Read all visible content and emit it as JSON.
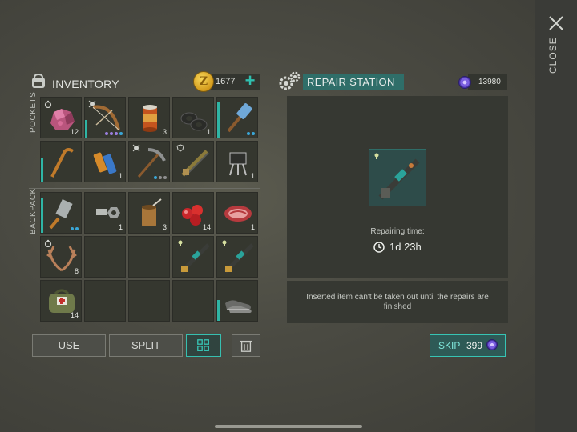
{
  "close": {
    "label": "CLOSE"
  },
  "inventory": {
    "title": "INVENTORY",
    "coins": "1677",
    "sections": {
      "pockets": "POCKETS",
      "backpack": "BACKPACK"
    },
    "items": [
      {
        "icon": "raw-ore-icon",
        "count": "12"
      },
      {
        "icon": "bow-icon",
        "count": ""
      },
      {
        "icon": "canned-food-icon",
        "count": "3"
      },
      {
        "icon": "duct-tape-icon",
        "count": "1"
      },
      {
        "icon": "sledgehammer-icon",
        "count": ""
      },
      {
        "icon": "crowbar-icon",
        "count": ""
      },
      {
        "icon": "batteries-icon",
        "count": "1"
      },
      {
        "icon": "pickaxe-icon",
        "count": ""
      },
      {
        "icon": "shotgun-icon",
        "count": ""
      },
      {
        "icon": "transistor-icon",
        "count": "1"
      },
      {
        "icon": "cleaver-icon",
        "count": ""
      },
      {
        "icon": "bolt-nut-icon",
        "count": "1"
      },
      {
        "icon": "open-can-icon",
        "count": "3"
      },
      {
        "icon": "berries-icon",
        "count": "14"
      },
      {
        "icon": "raw-meat-icon",
        "count": "1"
      },
      {
        "icon": "antlers-icon",
        "count": "8"
      },
      {
        "icon": "rifle-icon",
        "count": ""
      },
      {
        "icon": "rifle-icon",
        "count": ""
      },
      {
        "icon": "first-aid-bag-icon",
        "count": "14"
      },
      {
        "icon": "sneakers-icon",
        "count": ""
      }
    ],
    "buttons": {
      "use": "USE",
      "split": "SPLIT"
    }
  },
  "repair": {
    "title": "REPAIR STATION",
    "chips": "13980",
    "label": "Repairing time:",
    "time": "1d 23h",
    "note": "Inserted item can't be taken out until the repairs are finished",
    "skip_label": "SKIP",
    "skip_cost": "399"
  },
  "colors": {
    "accent": "#37c4b4",
    "panel": "#363832",
    "slot": "#35372f",
    "title_bg": "#2f6e69"
  }
}
